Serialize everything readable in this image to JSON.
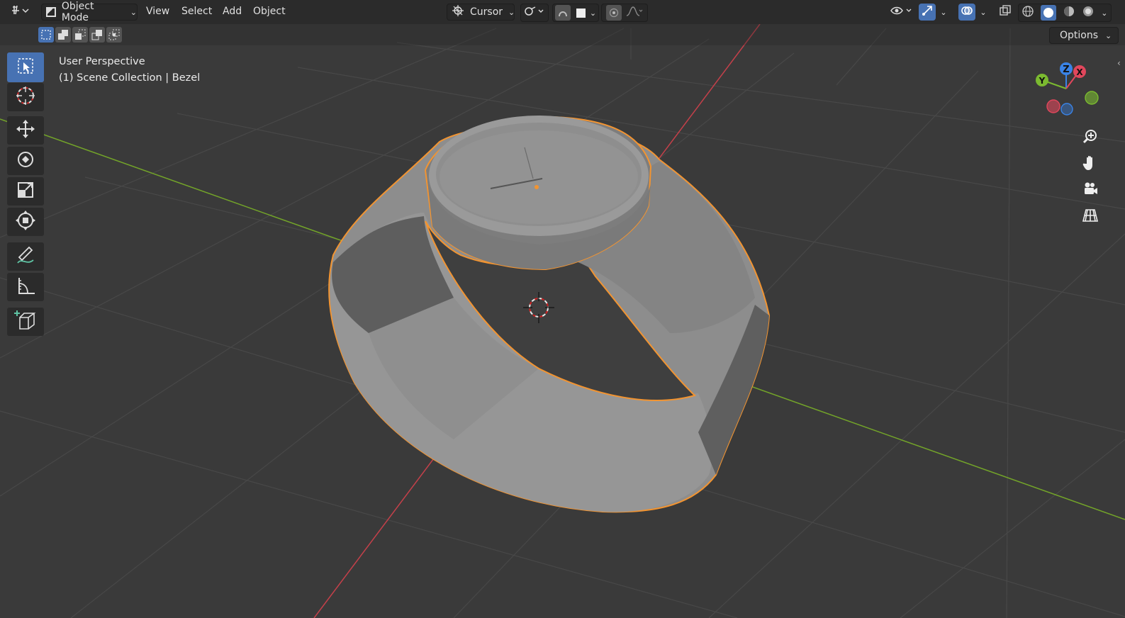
{
  "header": {
    "editor_type_icon": "viewport-icon",
    "mode_label": "Object Mode",
    "menus": [
      "View",
      "Select",
      "Add",
      "Object"
    ],
    "pivot_label": "Cursor",
    "options_label": "Options"
  },
  "overlay_info": {
    "view_name": "User Perspective",
    "collection": "(1) Scene Collection | Bezel"
  },
  "toolbar": {
    "tools": [
      "select-box-icon",
      "cursor-icon",
      "move-icon",
      "rotate-icon",
      "scale-icon",
      "transform-icon",
      "annotate-icon",
      "measure-icon",
      "add-cube-icon"
    ]
  },
  "gizmo": {
    "axes": [
      "X",
      "Y",
      "Z"
    ],
    "colors": {
      "x": "#e0475c",
      "y": "#7bba30",
      "z": "#3a83e6"
    }
  },
  "colors": {
    "accent": "#4772b3",
    "selection_outline": "#f29431",
    "x_axis_line": "#c4404a",
    "y_axis_line": "#73a429",
    "grid": "#484848"
  }
}
